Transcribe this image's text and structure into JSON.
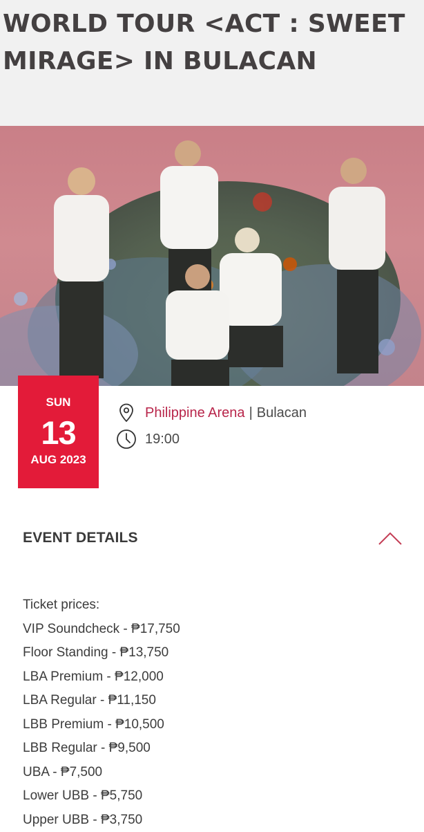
{
  "event": {
    "title": "WORLD TOUR <ACT : SWEET MIRAGE> IN BULACAN"
  },
  "date": {
    "day_of_week": "SUN",
    "day": "13",
    "month_year": "AUG 2023"
  },
  "venue": {
    "name": "Philippine Arena",
    "separator": "|",
    "city": "Bulacan",
    "icon": "map-pin-icon"
  },
  "time": {
    "value": "19:00",
    "icon": "clock-icon"
  },
  "details": {
    "heading": "EVENT DETAILS",
    "toggle_icon": "chevron-up-icon",
    "intro": "Ticket prices:",
    "prices": [
      "VIP Soundcheck - ₱17,750",
      "Floor Standing - ₱13,750",
      "LBA Premium - ₱12,000",
      "LBA Regular - ₱11,150",
      "LBB Premium - ₱10,500",
      "LBB Regular - ₱9,500",
      "UBA - ₱7,500",
      "Lower UBB - ₱5,750",
      "Upper UBB - ₱3,750"
    ]
  },
  "colors": {
    "accent_red": "#e31b39",
    "venue_link": "#b8254a",
    "title_text": "#444041"
  }
}
